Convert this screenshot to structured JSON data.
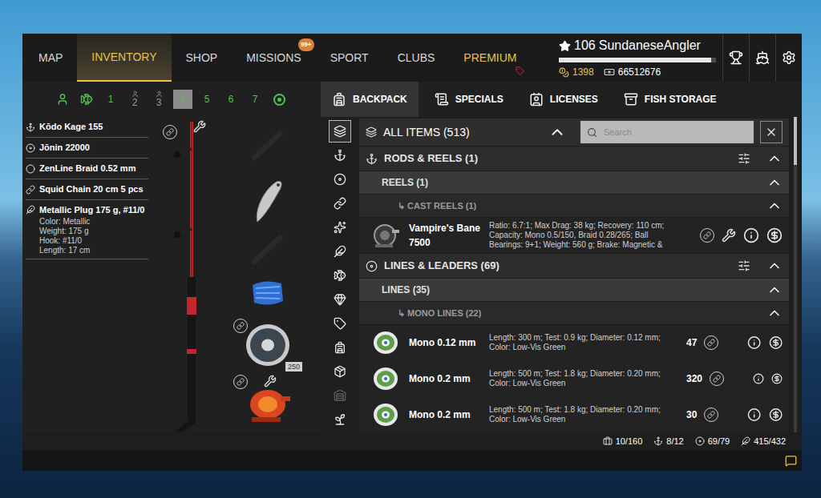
{
  "nav": {
    "tabs": [
      {
        "label": "MAP",
        "selected": false,
        "color": "#d8d8d8"
      },
      {
        "label": "INVENTORY",
        "selected": true,
        "color": "#e9c349"
      },
      {
        "label": "SHOP",
        "selected": false,
        "color": "#d8d8d8"
      },
      {
        "label": "MISSIONS",
        "selected": false,
        "color": "#d8d8d8",
        "badge": "99+"
      },
      {
        "label": "SPORT",
        "selected": false,
        "color": "#d8d8d8"
      },
      {
        "label": "CLUBS",
        "selected": false,
        "color": "#d8d8d8"
      },
      {
        "label": "PREMIUM",
        "selected": false,
        "color": "#e9c349"
      }
    ]
  },
  "player": {
    "rank": "106",
    "name": "SundaneseAngler",
    "xp": {
      "level": 0.97
    },
    "gold": "1398",
    "silver": "66512676"
  },
  "loadouts": [
    {
      "label": "1",
      "selected": false,
      "kind": "plain",
      "color": "#4fc24f"
    },
    {
      "label": "2",
      "selected": false,
      "kind": "marked",
      "color": "#9a9a9a"
    },
    {
      "label": "3",
      "selected": false,
      "kind": "marked",
      "color": "#9a9a9a"
    },
    {
      "label": "4",
      "selected": true,
      "kind": "plain",
      "color": "#4fc24f"
    },
    {
      "label": "5",
      "selected": false,
      "kind": "plain",
      "color": "#4fc24f"
    },
    {
      "label": "6",
      "selected": false,
      "kind": "plain",
      "color": "#4fc24f"
    },
    {
      "label": "7",
      "selected": false,
      "kind": "plain",
      "color": "#4fc24f"
    }
  ],
  "storage_tabs": [
    {
      "label": "BACKPACK",
      "selected": true
    },
    {
      "label": "SPECIALS",
      "selected": false
    },
    {
      "label": "LICENSES",
      "selected": false
    },
    {
      "label": "FISH STORAGE",
      "selected": false
    }
  ],
  "equipment": [
    {
      "label": "Kōdo Kage 155"
    },
    {
      "label": "Jōnin 22000"
    },
    {
      "label": "ZenLine Braid 0.52 mm"
    },
    {
      "label": "Squid Chain 20 cm 5 pcs"
    },
    {
      "label": "Metallic Plug 175 g, #11/0",
      "details": [
        "Color: Metallic",
        "Weight: 175 g",
        "Hook: #11/0",
        "Length: 17 cm"
      ]
    }
  ],
  "rod": {
    "spool_count": "250"
  },
  "categories": [
    {
      "selected": true,
      "disabled": false
    },
    {
      "selected": false,
      "disabled": false
    },
    {
      "selected": false,
      "disabled": false
    },
    {
      "selected": false,
      "disabled": false
    },
    {
      "selected": false,
      "disabled": false
    },
    {
      "selected": false,
      "disabled": false
    },
    {
      "selected": false,
      "disabled": false
    },
    {
      "selected": false,
      "disabled": false
    },
    {
      "selected": false,
      "disabled": false
    },
    {
      "selected": false,
      "disabled": false
    },
    {
      "selected": false,
      "disabled": false
    },
    {
      "selected": false,
      "disabled": true
    },
    {
      "selected": false,
      "disabled": false
    }
  ],
  "list": {
    "title": "ALL ITEMS (513)",
    "search": {
      "placeholder": "Search"
    },
    "rows": [
      {
        "kind": "category",
        "label": "RODS & REELS (1)"
      },
      {
        "kind": "group",
        "label": "REELS (1)"
      },
      {
        "kind": "subgroup",
        "label": "↳ CAST REELS (1)"
      },
      {
        "kind": "item",
        "image": "reel",
        "name": "Vampire's Bane 7500",
        "description": "Ratio: 6.7:1; Max Drag: 38 kg; Recovery: 110 cm; Capacity: Mono 0.5/150, Braid 0.28/265; Ball Bearings: 9+1; Weight: 560 g; Brake: Magnetic &",
        "wrench": true
      },
      {
        "kind": "category",
        "label": "LINES & LEADERS (69)"
      },
      {
        "kind": "group",
        "label": "LINES (35)"
      },
      {
        "kind": "subgroup",
        "label": "↳ MONO LINES (22)"
      },
      {
        "kind": "item",
        "image": "spool",
        "name": "Mono 0.12 mm",
        "description": "Length: 300 m; Test: 0.9 kg; Diameter: 0.12 mm; Color: Low-Vis Green",
        "count": "47",
        "wrench": false
      },
      {
        "kind": "item",
        "image": "spool",
        "name": "Mono 0.2 mm",
        "description": "Length: 500 m; Test: 1.8 kg; Diameter: 0.20 mm; Color: Low-Vis Green",
        "count": "320",
        "wrench": false
      },
      {
        "kind": "item",
        "image": "spool",
        "name": "Mono 0.2 mm",
        "description": "Length: 500 m; Test: 1.8 kg; Diameter: 0.20 mm; Color: Low-Vis Green",
        "count": "30",
        "wrench": false
      }
    ]
  },
  "status_bar": [
    {
      "value": "10/160"
    },
    {
      "value": "8/12"
    },
    {
      "value": "69/79"
    },
    {
      "value": "415/432"
    }
  ]
}
